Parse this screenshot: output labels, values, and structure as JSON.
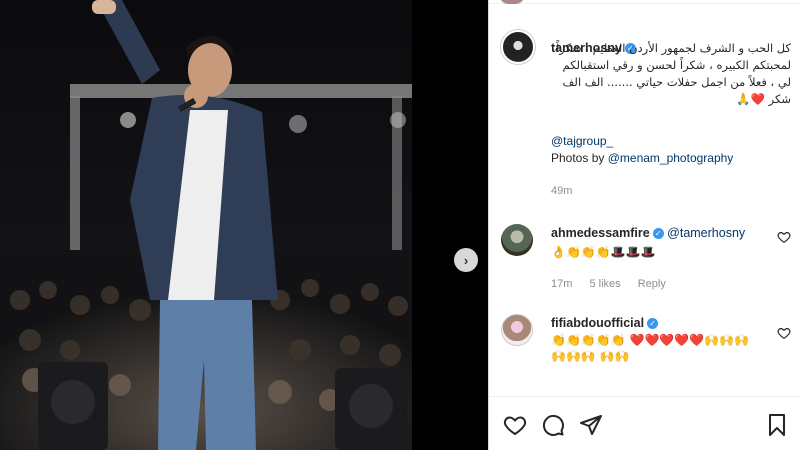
{
  "post": {
    "username": "tamerhosny",
    "caption": "كل الحب و الشرف لجمهور الأردن العظيم ، شكراً لمحبتكم الكبيره ، شكراً لحسن و رقي استقبالكم لي ، فعلاً من اجمل حفلات حياتي ....... الف الف شكر ❤️🙏",
    "tag": "@tajgroup_",
    "photos_by_label": "Photos by",
    "photos_by_handle": "@menam_photography",
    "time": "49m"
  },
  "comments": [
    {
      "username": "ahmedessamfire",
      "mention": "@tamerhosny",
      "text": "👌👏👏👏🎩🎩🎩",
      "time": "17m",
      "likes": "5 likes",
      "reply": "Reply"
    },
    {
      "username": "fifiabdouofficial",
      "text": "👏👏👏👏👏 ❤️❤️❤️❤️❤️🙌🙌🙌🙌🙌🙌 🙌🙌"
    }
  ],
  "icons": {
    "next": "chevron-right-icon",
    "like": "heart-icon",
    "comment": "comment-icon",
    "share": "share-icon",
    "save": "bookmark-icon",
    "verified": "verified-badge-icon"
  },
  "colors": {
    "link": "#00376b",
    "verified": "#3897f0",
    "meta": "#8e8e8e",
    "heart": "#ed4956"
  }
}
